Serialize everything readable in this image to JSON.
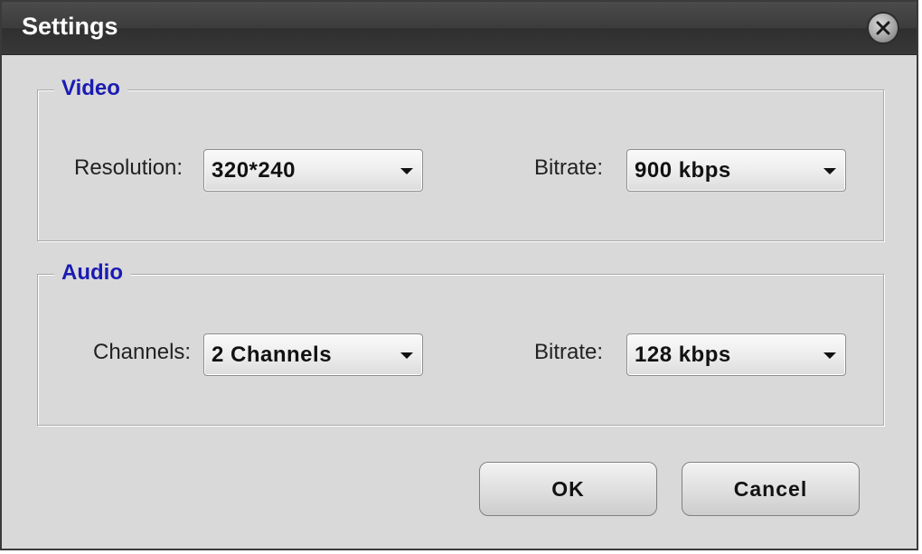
{
  "window": {
    "title": "Settings",
    "close_icon": "close-icon"
  },
  "video": {
    "legend": "Video",
    "resolution_label": "Resolution:",
    "resolution_value": "320*240",
    "bitrate_label": "Bitrate:",
    "bitrate_value": "900 kbps"
  },
  "audio": {
    "legend": "Audio",
    "channels_label": "Channels:",
    "channels_value": "2 Channels",
    "bitrate_label": "Bitrate:",
    "bitrate_value": "128 kbps"
  },
  "buttons": {
    "ok_label": "OK",
    "cancel_label": "Cancel"
  },
  "colors": {
    "titlebar": "#3c3c3c",
    "body": "#d9d9d9",
    "legend_text": "#1b1bb3"
  }
}
